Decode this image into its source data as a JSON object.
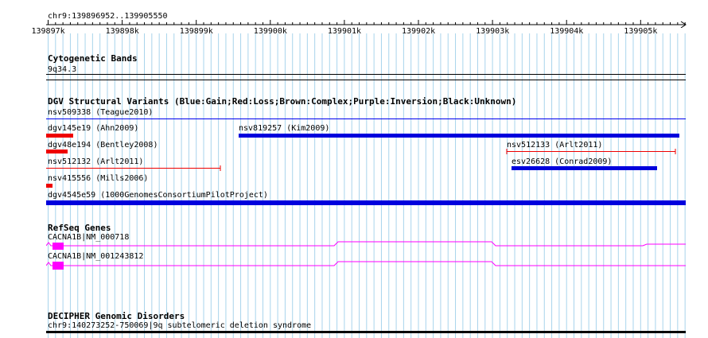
{
  "ruler": {
    "range_label": "chr9:139896952..139905550",
    "ticks": [
      "139897k",
      "139898k",
      "139899k",
      "139900k",
      "139901k",
      "139902k",
      "139903k",
      "139904k",
      "139905k"
    ]
  },
  "tracks": {
    "cytoband": {
      "title": "Cytogenetic Bands",
      "band": "9q34.3"
    },
    "dgv": {
      "title": "DGV Structural Variants (Blue:Gain;Red:Loss;Brown:Complex;Purple:Inversion;Black:Unknown)",
      "features": [
        {
          "label": "nsv509338 (Teague2010)",
          "color": "#0000ff"
        },
        {
          "label": "dgv145e19 (Ahn2009)",
          "color": "#ee0000"
        },
        {
          "label": "nsv819257 (Kim2009)",
          "color": "#0000dd"
        },
        {
          "label": "dgv48e194 (Bentley2008)",
          "color": "#ee0000"
        },
        {
          "label": "nsv512133 (Arlt2011)",
          "color": "#ee0000"
        },
        {
          "label": "nsv512132 (Arlt2011)",
          "color": "#ee0000"
        },
        {
          "label": "esv26628 (Conrad2009)",
          "color": "#0000dd"
        },
        {
          "label": "nsv415556 (Mills2006)",
          "color": "#ee0000"
        },
        {
          "label": "dgv4545e59 (1000GenomesConsortiumPilotProject)",
          "color": "#0000dd"
        }
      ]
    },
    "refseq": {
      "title": "RefSeq Genes",
      "genes": [
        {
          "label": "CACNA1B|NM_000718"
        },
        {
          "label": "CACNA1B|NM_001243812"
        }
      ],
      "color": "#ff00ff"
    },
    "decipher": {
      "title": "DECIPHER Genomic Disorders",
      "feature": "chr9:140273252-750069|9q subtelomeric deletion syndrome"
    }
  },
  "colors": {
    "grid": "#a8d4ec",
    "gain": "#0000dd",
    "loss": "#ee0000",
    "gene": "#ff00ff"
  }
}
